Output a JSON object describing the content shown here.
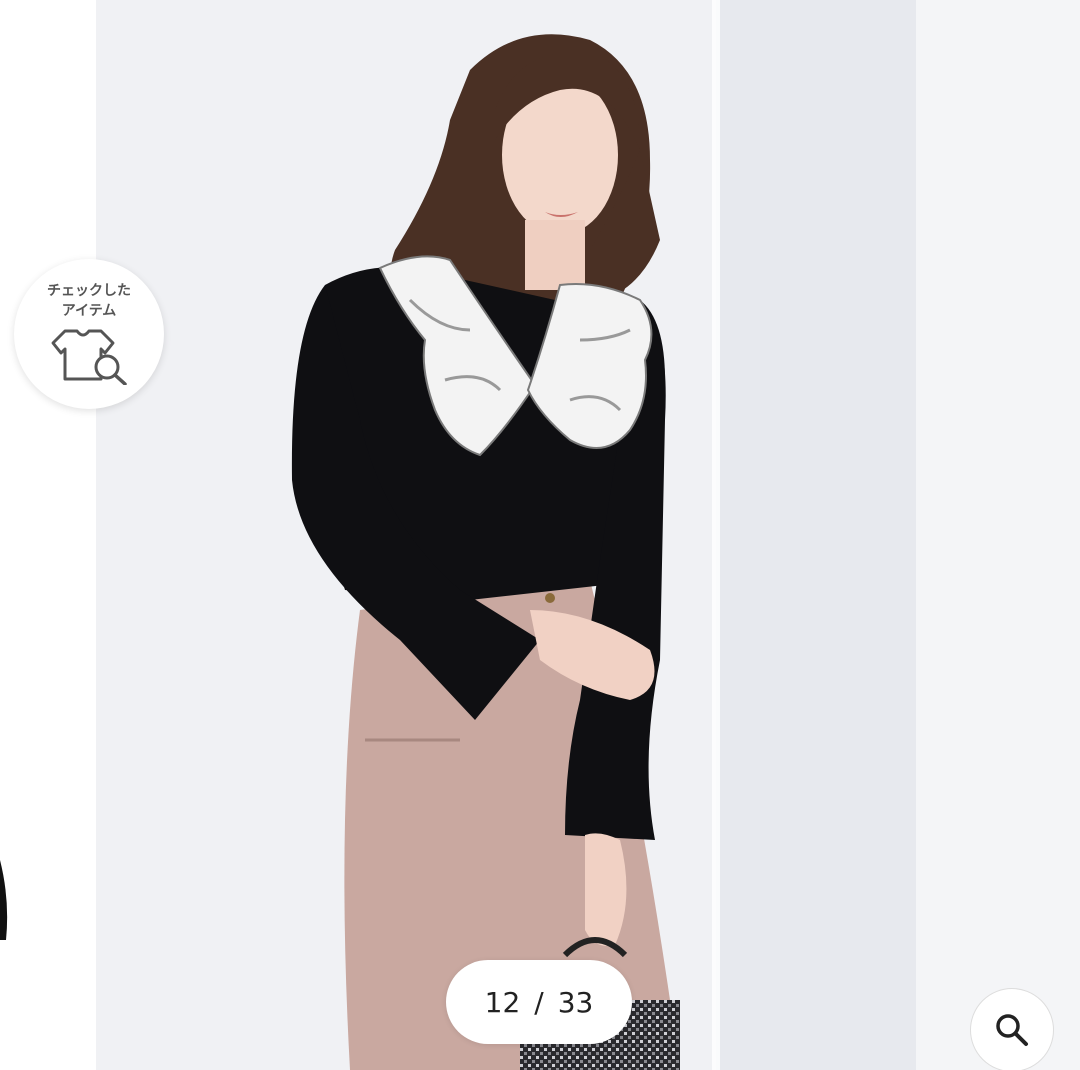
{
  "gallery": {
    "photo_alt": "Model wearing black ribbed knit top with white embroidered collar and pink skirt",
    "current_index": "12",
    "separator": "/",
    "total": "33"
  },
  "checked_items": {
    "label_line1": "チェックした",
    "label_line2": "アイテム",
    "icon": "tshirt-search-icon"
  },
  "zoom": {
    "icon": "magnifier-icon"
  },
  "colors": {
    "background": "#ffffff",
    "top": "#0f0f12",
    "collar": "#f3f3f3",
    "skirt": "#c9a8a0",
    "hair": "#4a3024",
    "wall": "#eef0f3"
  }
}
